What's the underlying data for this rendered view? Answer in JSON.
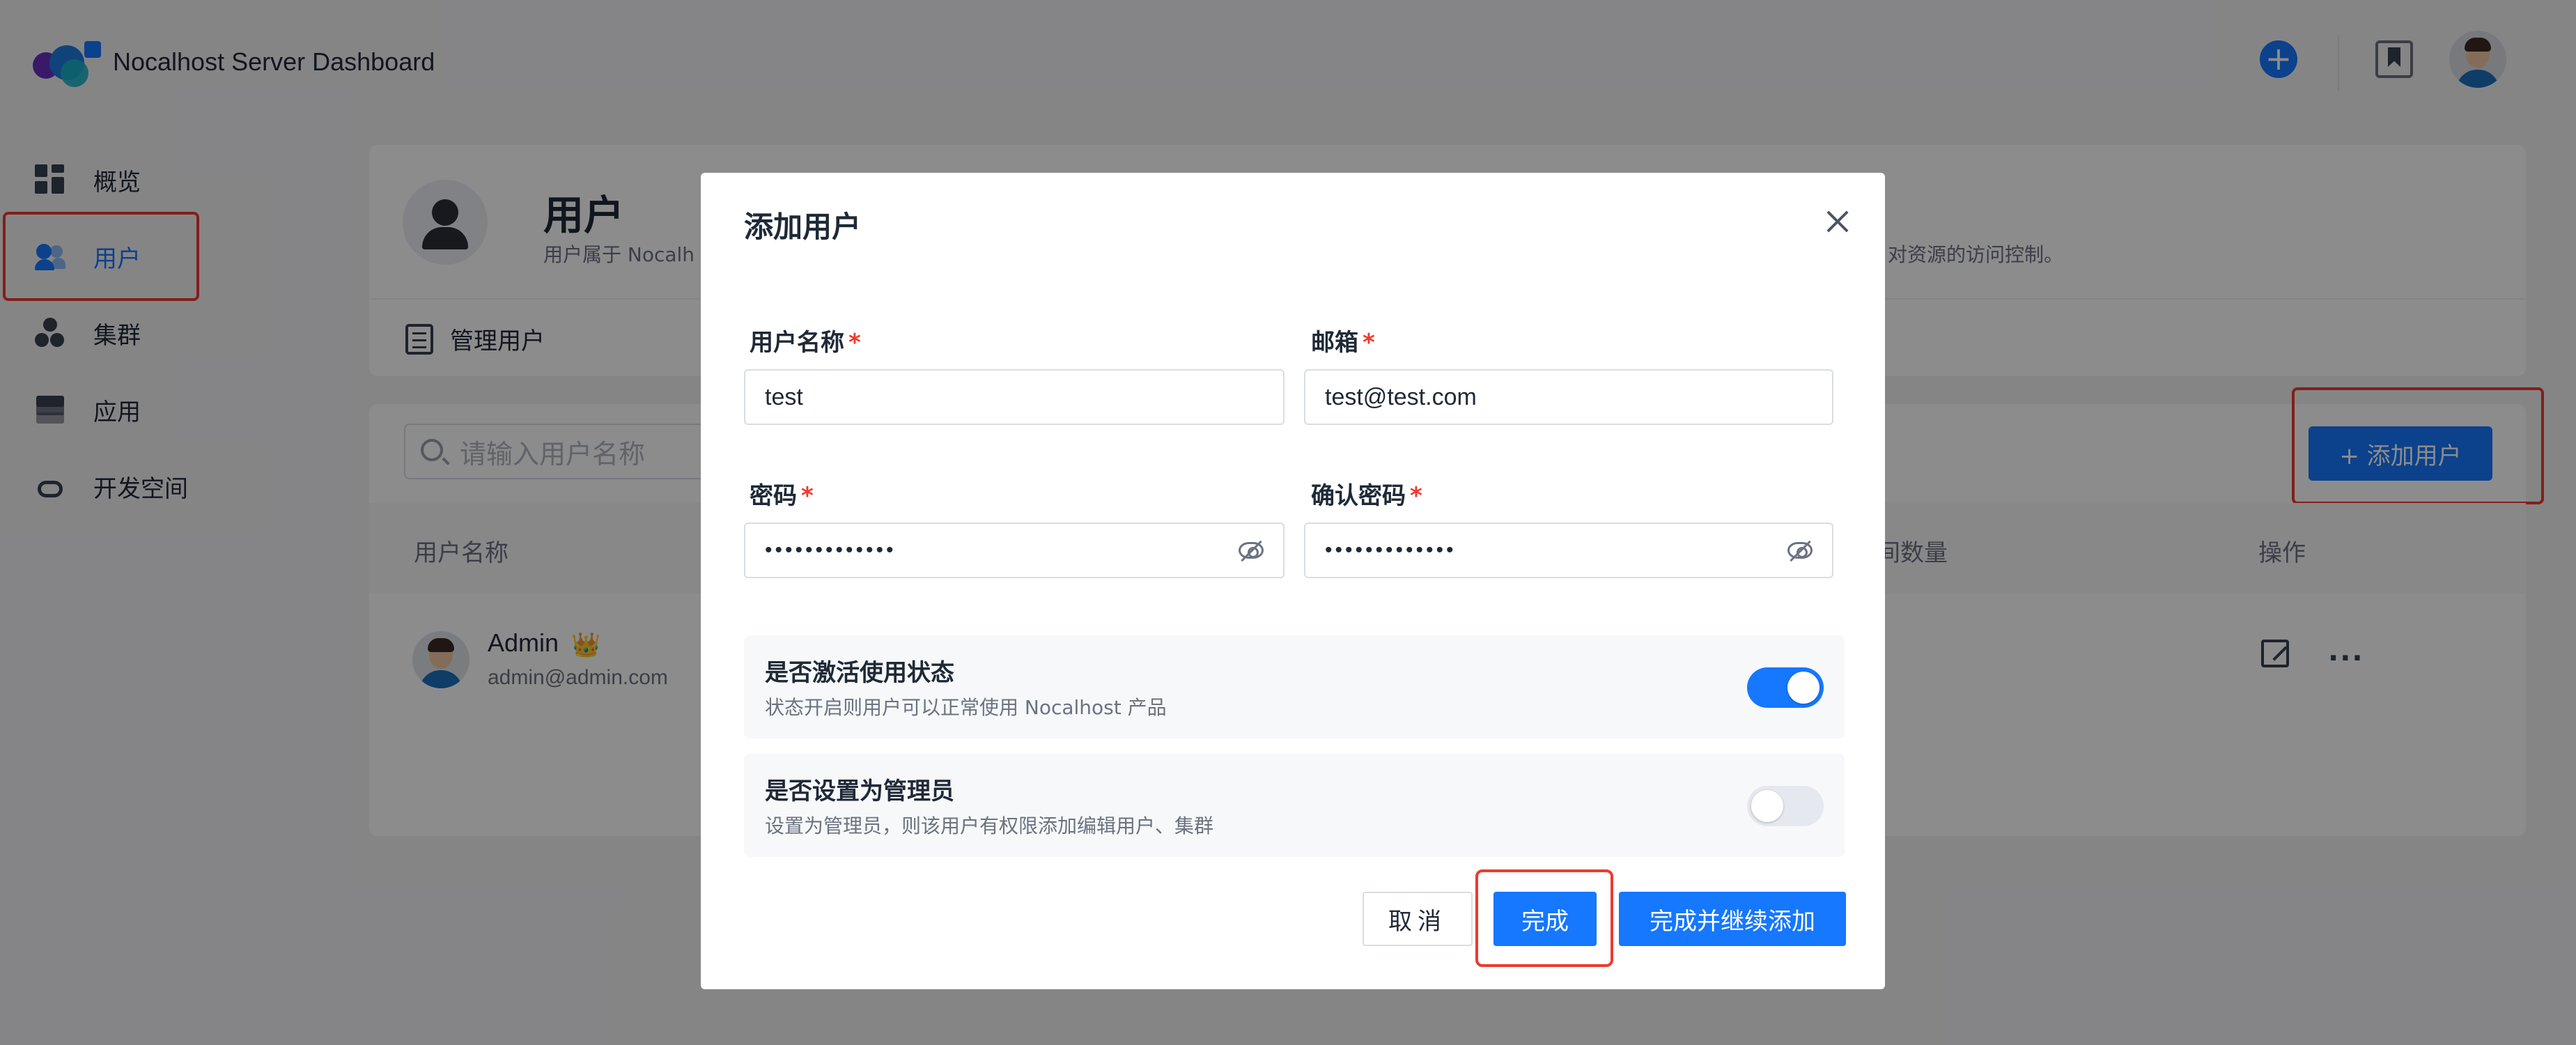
{
  "app": {
    "title": "Nocalhost Server Dashboard"
  },
  "sidebar": {
    "items": [
      {
        "label": "概览",
        "icon": "dashboard-icon"
      },
      {
        "label": "用户",
        "icon": "users-icon",
        "active": true
      },
      {
        "label": "集群",
        "icon": "cluster-icon"
      },
      {
        "label": "应用",
        "icon": "layers-icon"
      },
      {
        "label": "开发空间",
        "icon": "cloud-icon"
      }
    ]
  },
  "header": {
    "title": "用户",
    "desc_left": "用户属于 Nocalh",
    "desc_right": "对资源的访问控制。",
    "tab": "管理用户"
  },
  "toolbar": {
    "search_placeholder": "请输入用户名称",
    "add_user": "+ 添加用户"
  },
  "table": {
    "columns": [
      "用户名称",
      "间数量",
      "操作"
    ],
    "rows": [
      {
        "name": "Admin",
        "email": "admin@admin.com",
        "badge": "👑"
      }
    ]
  },
  "modal": {
    "title": "添加用户",
    "fields": {
      "username": {
        "label": "用户名称",
        "required": "*",
        "value": "test"
      },
      "email": {
        "label": "邮箱",
        "required": "*",
        "value": "test@test.com"
      },
      "password": {
        "label": "密码",
        "required": "*",
        "value": "•••••••••••••"
      },
      "confirm": {
        "label": "确认密码",
        "required": "*",
        "value": "•••••••••••••"
      }
    },
    "active_toggle": {
      "title": "是否激活使用状态",
      "desc": "状态开启则用户可以正常使用 Nocalhost 产品",
      "on": true
    },
    "admin_toggle": {
      "title": "是否设置为管理员",
      "desc": "设置为管理员，则该用户有权限添加编辑用户、集群",
      "on": false
    },
    "buttons": {
      "cancel": "取消",
      "done": "完成",
      "done_continue": "完成并继续添加"
    }
  },
  "colors": {
    "primary": "#1677ff",
    "highlight": "#ee3a2f"
  }
}
